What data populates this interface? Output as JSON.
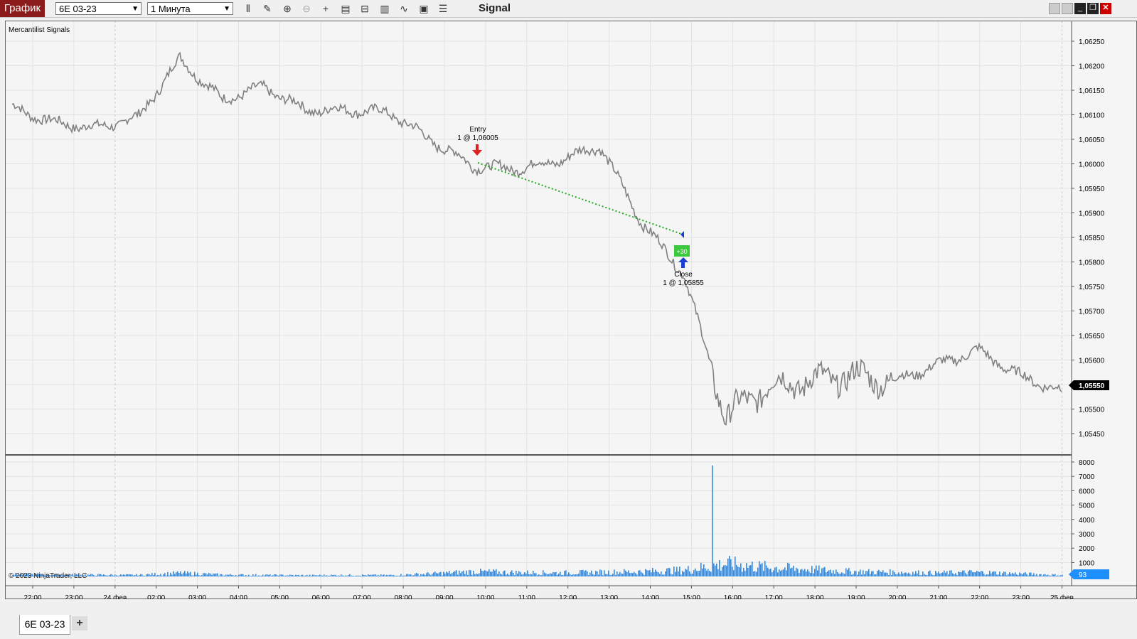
{
  "toolbar": {
    "app_label": "График",
    "instrument": "6E 03-23",
    "interval": "1 Минута",
    "title": "Signal",
    "tool_icons": [
      "bar-type-icon",
      "pencil-icon",
      "zoom-in-icon",
      "zoom-out-icon",
      "crosshair-icon",
      "data-box-icon",
      "properties-icon",
      "indicators-icon",
      "strategies-icon",
      "templates-icon",
      "menu-icon"
    ]
  },
  "chart": {
    "indicator_label": "Mercantilist Signals",
    "copyright": "© 2023 NinjaTrader, LLC",
    "price_labels": [
      "1,06250",
      "1,06200",
      "1,06150",
      "1,06100",
      "1,06050",
      "1,06000",
      "1,05950",
      "1,05900",
      "1,05850",
      "1,05800",
      "1,05750",
      "1,05700",
      "1,05650",
      "1,05600",
      "1,05550",
      "1,05500",
      "1,05450"
    ],
    "current_price": "1,05550",
    "volume_labels": [
      "8000",
      "7000",
      "6000",
      "5000",
      "4000",
      "3000",
      "2000",
      "1000"
    ],
    "current_volume": "93",
    "time_labels": [
      "22:00",
      "23:00",
      "24 фев",
      "02:00",
      "03:00",
      "04:00",
      "05:00",
      "06:00",
      "07:00",
      "08:00",
      "09:00",
      "10:00",
      "11:00",
      "12:00",
      "13:00",
      "14:00",
      "15:00",
      "16:00",
      "17:00",
      "18:00",
      "19:00",
      "20:00",
      "21:00",
      "22:00",
      "23:00",
      "25 фев"
    ],
    "entry": {
      "title": "Entry",
      "detail": "1 @ 1,06005"
    },
    "exit": {
      "title": "Close",
      "detail": "1 @ 1,05855",
      "pnl": "+30"
    },
    "colors": {
      "price": "#808080",
      "volume": "#1e90ff",
      "trade_line": "#22aa22",
      "entry_arrow": "#e02020",
      "exit_arrow": "#1a3fd0",
      "pnl_badge": "#3cc83c"
    }
  },
  "chart_data": {
    "type": "line",
    "title": "",
    "xlabel": "",
    "ylabel": "",
    "x": [
      "22:00",
      "23:00",
      "24 фев",
      "02:00",
      "03:00",
      "04:00",
      "05:00",
      "06:00",
      "07:00",
      "08:00",
      "09:00",
      "10:00",
      "11:00",
      "12:00",
      "13:00",
      "14:00",
      "15:00",
      "16:00",
      "17:00",
      "18:00",
      "19:00",
      "20:00",
      "21:00",
      "22:00",
      "23:00",
      "25 фев"
    ],
    "series": [
      {
        "values": [
          1.06105,
          1.06075,
          1.06065,
          1.06085,
          1.062,
          1.0612,
          1.06145,
          1.061,
          1.061,
          1.06095,
          1.0604,
          1.0599,
          1.05985,
          1.06,
          1.0603,
          1.0588,
          1.0578,
          1.055,
          1.0556,
          1.0557,
          1.0558,
          1.0557,
          1.056,
          1.0563,
          1.0558,
          1.0555
        ]
      },
      {
        "values": [
          150,
          120,
          110,
          100,
          250,
          120,
          100,
          80,
          100,
          90,
          200,
          350,
          280,
          260,
          300,
          350,
          450,
          900,
          650,
          500,
          350,
          300,
          250,
          300,
          200,
          93
        ]
      }
    ],
    "ylim": [
      1.05425,
      1.06275
    ],
    "volume_ylim": [
      0,
      8500
    ],
    "volume_spike": 8000
  }
}
